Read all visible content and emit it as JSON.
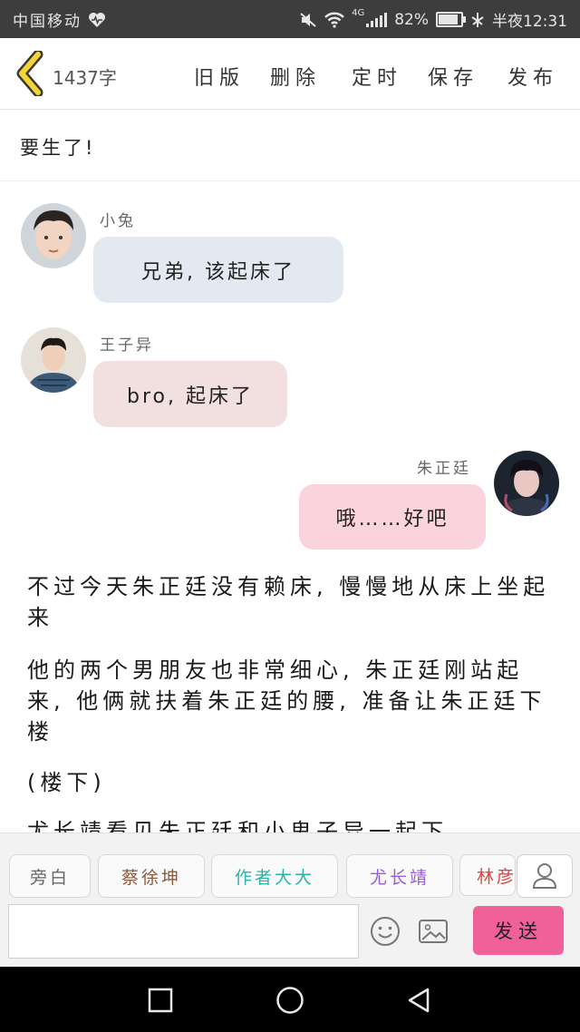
{
  "status_bar": {
    "carrier": "中国移动",
    "network": "4G",
    "battery": "82%",
    "time": "半夜12:31"
  },
  "toolbar": {
    "word_count": "1437字",
    "old_version": "旧版",
    "delete": "删除",
    "schedule": "定时",
    "save": "保存",
    "publish": "发布"
  },
  "chapter_title": "要生了!",
  "messages": [
    {
      "sender": "小兔",
      "text": "兄弟, 该起床了",
      "side": "left",
      "bubble_color": "#e3e9f1"
    },
    {
      "sender": "王子异",
      "text": "bro, 起床了",
      "side": "left",
      "bubble_color": "#f2dfe0"
    },
    {
      "sender": "朱正廷",
      "text": "哦……好吧",
      "side": "right",
      "bubble_color": "#fbd3dd"
    }
  ],
  "story_paragraphs": [
    "不过今天朱正廷没有赖床, 慢慢地从床上坐起来",
    "他的两个男朋友也非常细心, 朱正廷刚站起来, 他俩就扶着朱正廷的腰, 准备让朱正廷下楼",
    "(楼下)",
    "尤长靖看见朱正廷和小鬼子异一起下"
  ],
  "role_chips": [
    {
      "label": "旁白",
      "color": "#666666"
    },
    {
      "label": "蔡徐坤",
      "color": "#8a5a3c"
    },
    {
      "label": "作者大大",
      "color": "#2bb3a8"
    },
    {
      "label": "尤长靖",
      "color": "#9a5bd6"
    },
    {
      "label": "林彦俊",
      "color": "#e0443c"
    }
  ],
  "composer": {
    "placeholder": "",
    "send_label": "发送"
  },
  "icons": [
    "back-arrow-icon",
    "user-icon",
    "emoji-icon",
    "image-icon",
    "back-nav-icon",
    "home-nav-icon",
    "recent-apps-icon"
  ]
}
